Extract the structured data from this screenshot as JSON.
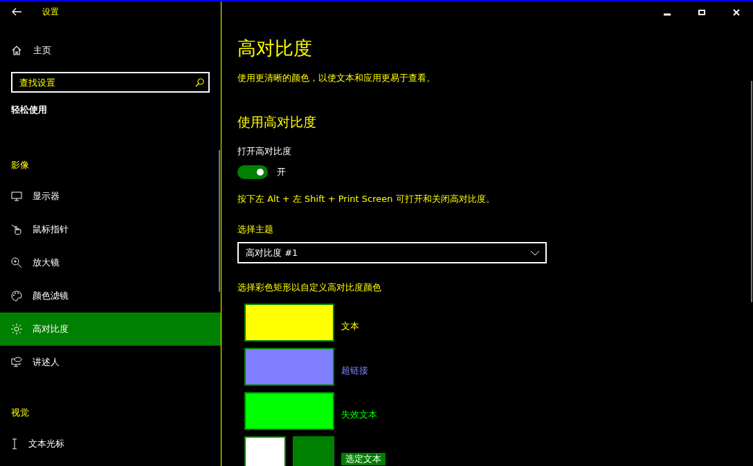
{
  "window": {
    "title": "设置"
  },
  "sidebar": {
    "home": "主页",
    "search": {
      "placeholder": "查找设置"
    },
    "heading": "轻松使用",
    "groups": [
      {
        "title": "影像",
        "items": [
          {
            "label": "显示器",
            "kind": "monitor",
            "selected": false
          },
          {
            "label": "鼠标指针",
            "kind": "pointer",
            "selected": false
          },
          {
            "label": "放大镜",
            "kind": "magnifier",
            "selected": false
          },
          {
            "label": "颜色滤镜",
            "kind": "palette",
            "selected": false
          },
          {
            "label": "高对比度",
            "kind": "sun",
            "selected": true
          },
          {
            "label": "讲述人",
            "kind": "narrator",
            "selected": false
          }
        ]
      },
      {
        "title": "视觉",
        "items": [
          {
            "label": "文本光标",
            "kind": "cursor",
            "selected": false
          }
        ]
      }
    ]
  },
  "page": {
    "title": "高对比度",
    "description": "使用更清晰的颜色，以使文本和应用更易于查看。",
    "section": "使用高对比度",
    "toggle": {
      "label": "打开高对比度",
      "on": true,
      "state": "开"
    },
    "hint": "按下左 Alt + 左 Shift + Print Screen 可打开和关闭高对比度。",
    "theme": {
      "label": "选择主题",
      "value": "高对比度 #1"
    },
    "colors_label": "选择彩色矩形以自定义高对比度颜色",
    "swatches": [
      {
        "kind": "single",
        "label": "文本",
        "color": "#ffff00"
      },
      {
        "kind": "single",
        "label": "超链接",
        "color": "#8080ff"
      },
      {
        "kind": "single",
        "label": "失效文本",
        "color": "#00ff00"
      },
      {
        "kind": "pair",
        "label": "选定文本",
        "color": "#ffffff"
      }
    ]
  }
}
